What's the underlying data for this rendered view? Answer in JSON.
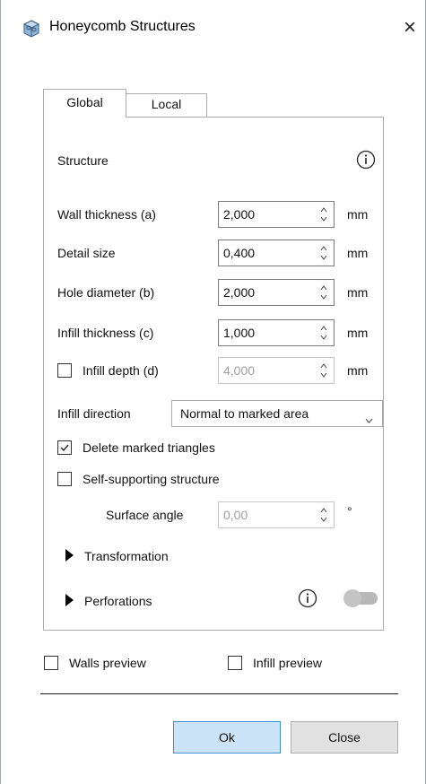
{
  "window": {
    "title": "Honeycomb Structures",
    "close_glyph": "×",
    "app_icon": "cube-icon"
  },
  "tabs": [
    {
      "label": "Global",
      "active": true
    },
    {
      "label": "Local",
      "active": false
    }
  ],
  "structure": {
    "heading": "Structure",
    "wall_thickness": {
      "label": "Wall thickness (a)",
      "value": "2,000",
      "unit": "mm"
    },
    "detail_size": {
      "label": "Detail size",
      "value": "0,400",
      "unit": "mm"
    },
    "hole_diameter": {
      "label": "Hole diameter (b)",
      "value": "2,000",
      "unit": "mm"
    },
    "infill_thickness": {
      "label": "Infill thickness (c)",
      "value": "1,000",
      "unit": "mm"
    },
    "infill_depth": {
      "label": "Infill depth (d)",
      "value": "4,000",
      "unit": "mm",
      "checked": false,
      "enabled": false
    },
    "infill_direction": {
      "label": "Infill direction",
      "value": "Normal to marked area"
    },
    "delete_marked": {
      "label": "Delete marked triangles",
      "checked": true
    },
    "self_supporting": {
      "label": "Self-supporting structure",
      "checked": false
    },
    "surface_angle": {
      "label": "Surface angle",
      "value": "0,00",
      "unit": "°",
      "enabled": false
    }
  },
  "sections": {
    "transformation": "Transformation",
    "perforations": "Perforations",
    "perforations_enabled": false
  },
  "preview": {
    "walls": {
      "label": "Walls preview",
      "checked": false
    },
    "infill": {
      "label": "Infill preview",
      "checked": false
    }
  },
  "buttons": {
    "ok": "Ok",
    "close": "Close"
  },
  "colors": {
    "ok_bg": "#cce4f7",
    "ok_border": "#3c8ed6",
    "toggle_off": "#b8b8b8"
  }
}
